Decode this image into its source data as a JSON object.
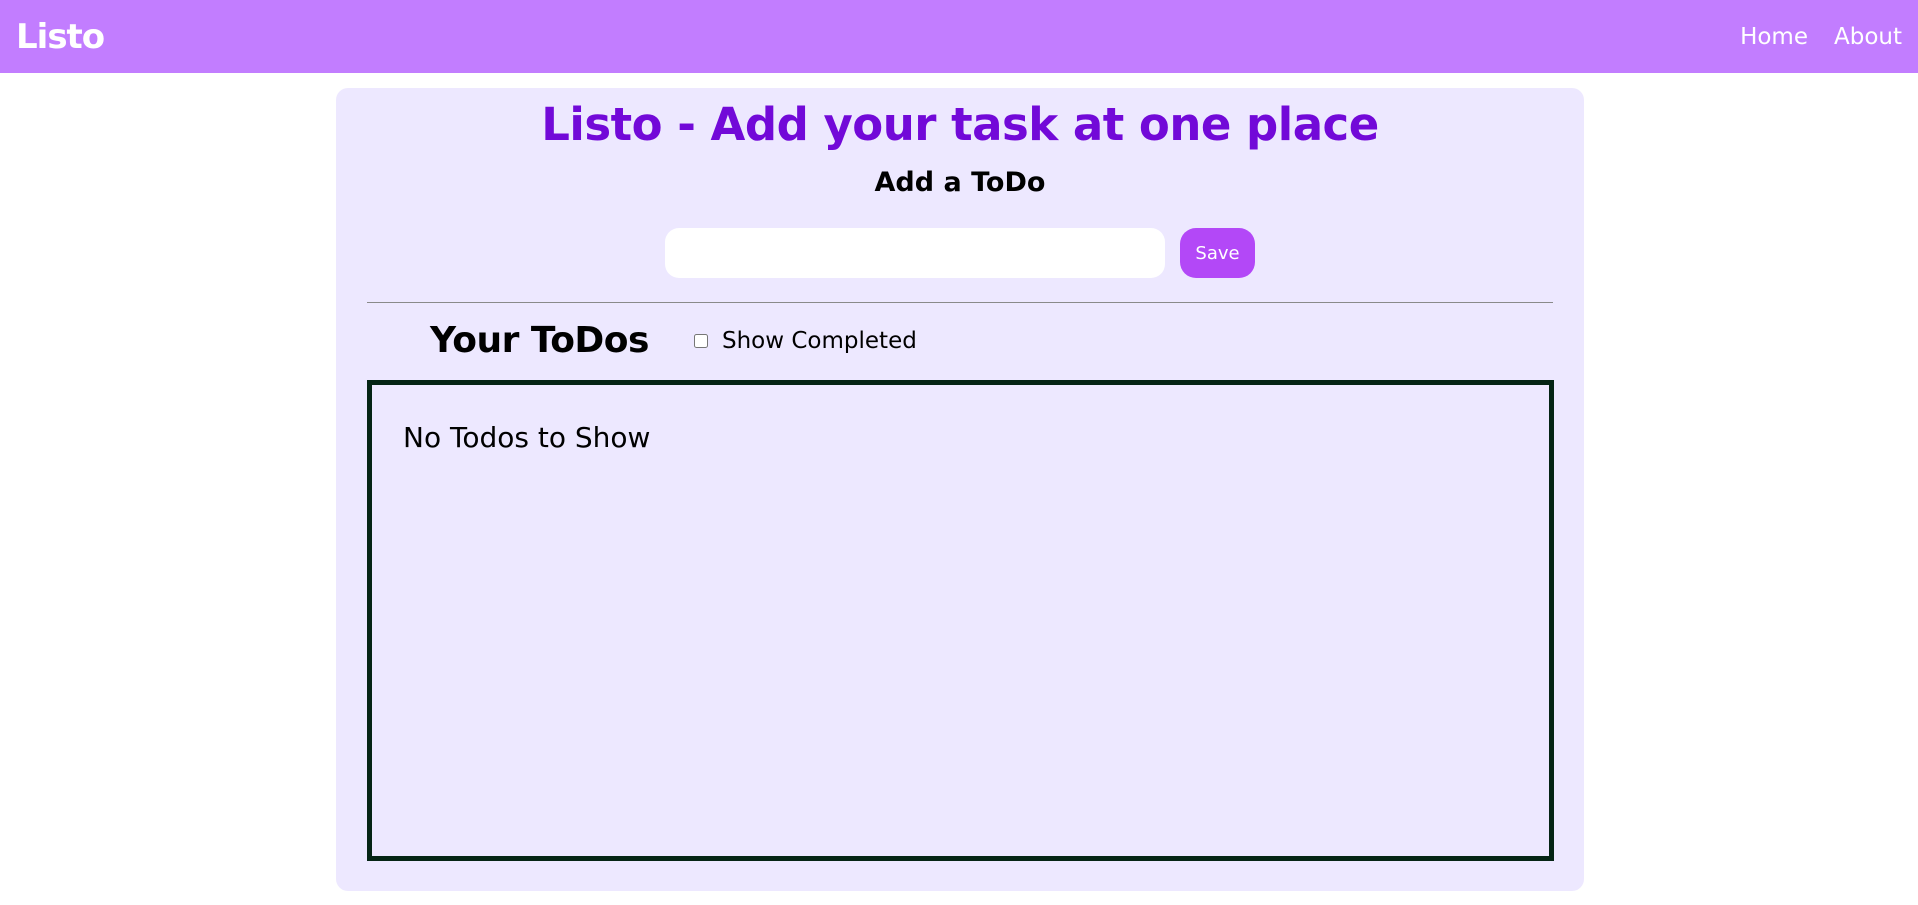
{
  "navbar": {
    "brand": "Listo",
    "links": [
      {
        "label": "Home"
      },
      {
        "label": "About"
      }
    ]
  },
  "main": {
    "title": "Listo - Add your task at one place",
    "add_section_title": "Add a ToDo",
    "input": {
      "value": "",
      "placeholder": ""
    },
    "save_label": "Save",
    "todos_title": "Your ToDos",
    "show_completed_label": "Show Completed",
    "show_completed_checked": false,
    "empty_message": "No Todos to Show"
  },
  "colors": {
    "navbar": "#c27dff",
    "card": "#ede8ff",
    "title": "#7209d8",
    "save_button": "#b348f7",
    "todos_border": "#052415"
  }
}
